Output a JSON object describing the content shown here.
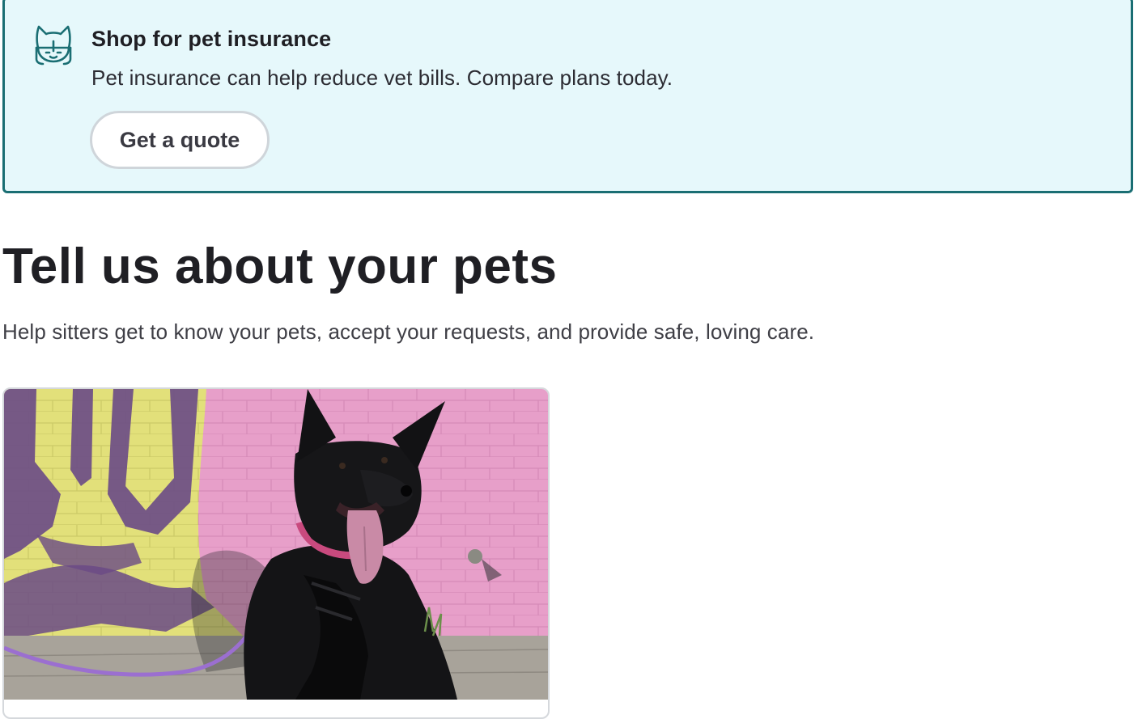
{
  "insurance_banner": {
    "title": "Shop for pet insurance",
    "text": "Pet insurance can help reduce vet bills. Compare plans today.",
    "button_label": "Get a quote",
    "icon": "cat-face-icon",
    "accent_color": "#1a6e73",
    "background_color": "#e6f8fb"
  },
  "main": {
    "title": "Tell us about your pets",
    "subtitle": "Help sitters get to know your pets, accept your requests, and provide safe, loving care."
  },
  "pet_card": {
    "photo_subject": "black dog in harness sitting in front of a pink and yellow painted brick wall"
  }
}
